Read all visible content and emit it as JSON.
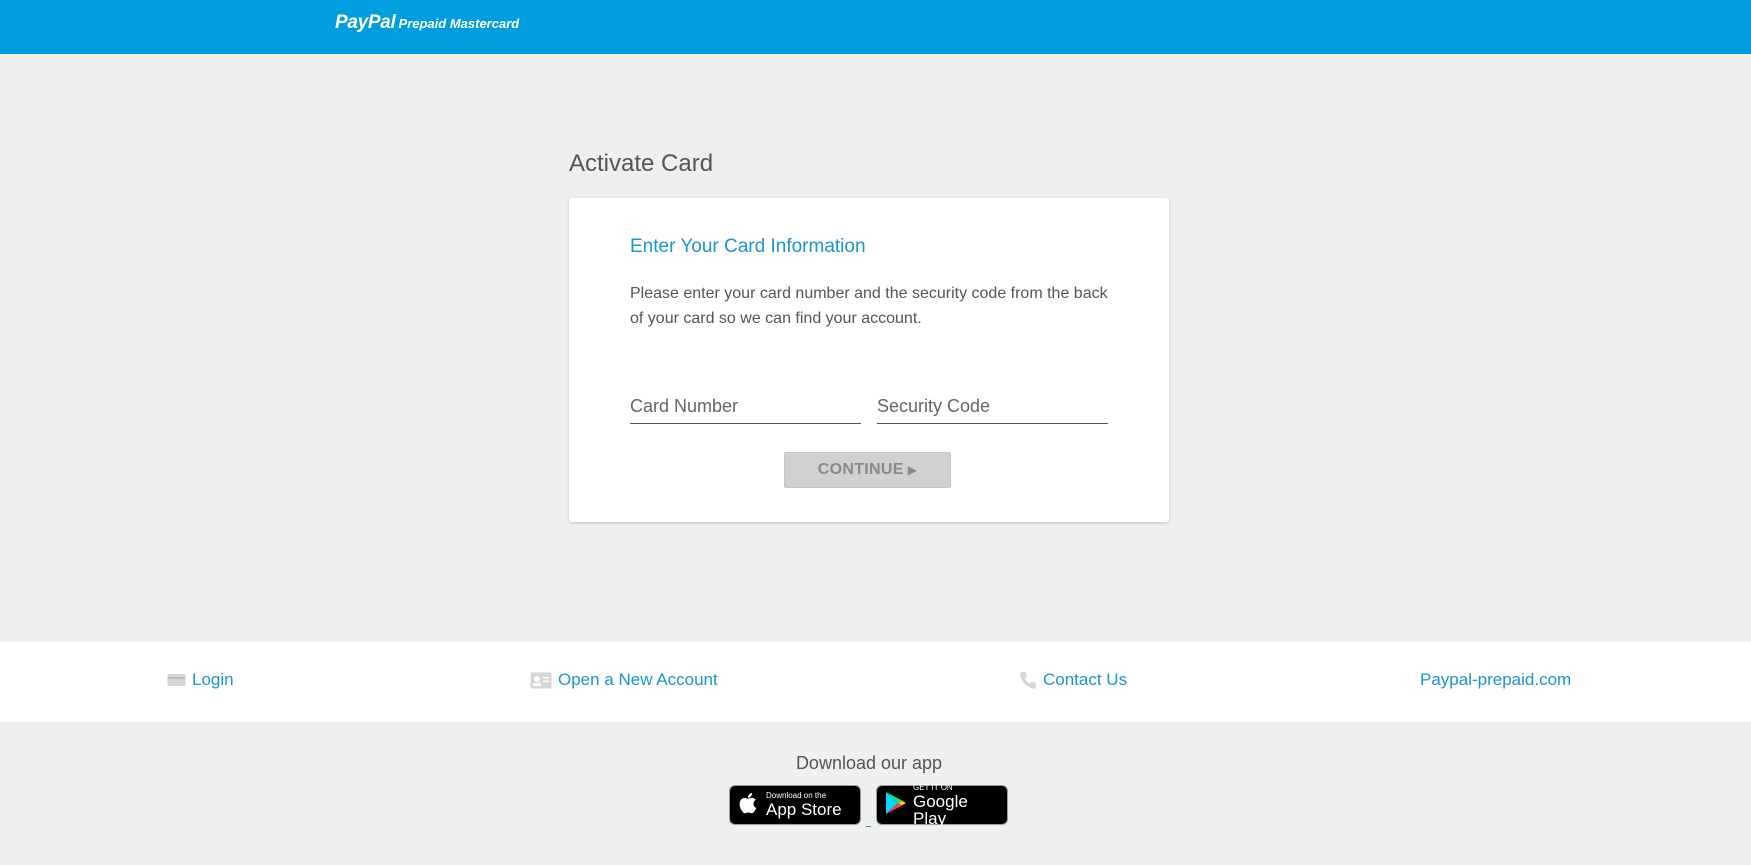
{
  "header": {
    "logo_brand": "PayPal",
    "logo_product": "Prepaid Mastercard"
  },
  "page": {
    "title": "Activate Card"
  },
  "card": {
    "heading": "Enter Your Card Information",
    "description": "Please enter your card number and the security code from the back of your card so we can find your account.",
    "card_number_placeholder": "Card Number",
    "card_number_value": "",
    "security_code_placeholder": "Security Code",
    "security_code_value": "",
    "continue_label": "CONTINUE",
    "continue_arrow": "▶"
  },
  "footer": {
    "links": [
      {
        "label": "Login",
        "icon": "card-icon"
      },
      {
        "label": "Open a New Account",
        "icon": "id-card-icon"
      },
      {
        "label": "Contact Us",
        "icon": "phone-icon"
      },
      {
        "label": "Paypal-prepaid.com"
      }
    ],
    "download_label": "Download our app",
    "app_store": {
      "small": "Download on the",
      "big": "App Store"
    },
    "google_play": {
      "small": "GET IT ON",
      "big": "Google Play"
    }
  },
  "colors": {
    "header_blue": "#009ddf",
    "link_blue": "#1a95d2",
    "page_bg": "#efefef",
    "button_disabled": "#d1d1d1"
  }
}
